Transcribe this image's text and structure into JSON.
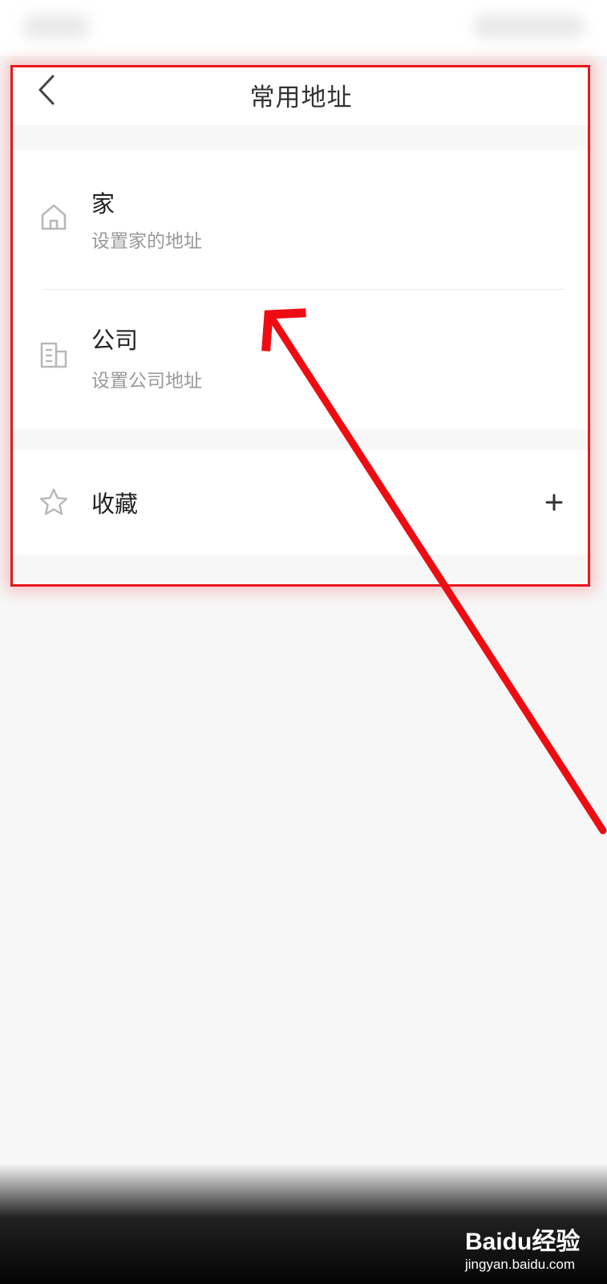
{
  "header": {
    "title": "常用地址",
    "back_icon": "chevron-left-icon"
  },
  "addresses": [
    {
      "icon": "home-icon",
      "title": "家",
      "subtitle": "设置家的地址"
    },
    {
      "icon": "building-icon",
      "title": "公司",
      "subtitle": "设置公司地址"
    }
  ],
  "favorites": {
    "icon": "star-icon",
    "label": "收藏",
    "add_icon": "plus-icon"
  },
  "annotation": {
    "highlight_color": "#e8151e",
    "arrow_color": "#ee0c12"
  },
  "watermark": {
    "brand": "Baidu经验",
    "url": "jingyan.baidu.com"
  },
  "colors": {
    "page_background": "#f7f7f7",
    "card_background": "#ffffff",
    "title_text": "#222222",
    "subtitle_text": "#999999",
    "icon_gray": "#b8b8b8"
  }
}
